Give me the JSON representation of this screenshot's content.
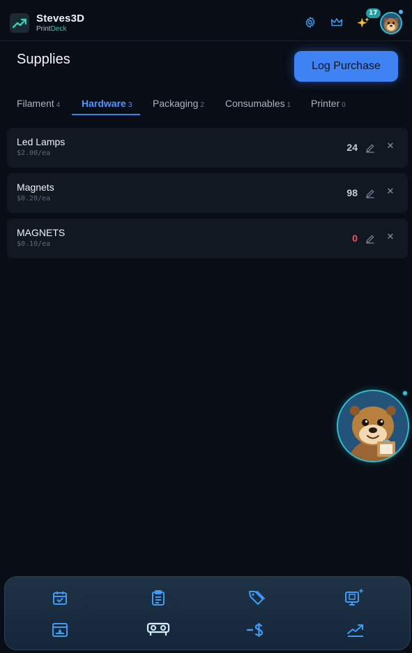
{
  "header": {
    "brand_name": "Steves3D",
    "brand_sub_prefix": "Print",
    "brand_sub_accent": "Deck",
    "notification_count": "17",
    "icons": [
      "trending-up-icon",
      "gear-icon",
      "crown-icon",
      "sparkles-icon",
      "avatar"
    ]
  },
  "page": {
    "title": "Supplies",
    "log_button": "Log Purchase"
  },
  "tabs": [
    {
      "label": "Filament",
      "count": "4",
      "active": false
    },
    {
      "label": "Hardware",
      "count": "3",
      "active": true
    },
    {
      "label": "Packaging",
      "count": "2",
      "active": false
    },
    {
      "label": "Consumables",
      "count": "1",
      "active": false
    },
    {
      "label": "Printer",
      "count": "0",
      "active": false
    }
  ],
  "items": [
    {
      "name": "Led Lamps",
      "price": "$2.00/ea",
      "qty": "24"
    },
    {
      "name": "Magnets",
      "price": "$0.20/ea",
      "qty": "98"
    },
    {
      "name": "MAGNETS",
      "price": "$0.10/ea",
      "qty": "0"
    }
  ],
  "bottom_nav": [
    "calendar-check-icon",
    "clipboard-list-icon",
    "tags-icon",
    "monitor-sparkle-icon",
    "printer-board-icon",
    "spool-icon",
    "minus-dollar-icon",
    "trending-up-icon"
  ],
  "colors": {
    "background": "#090d16",
    "accent": "#3f82f4",
    "teal": "#2fc6b8",
    "danger": "#ff4d5e"
  }
}
